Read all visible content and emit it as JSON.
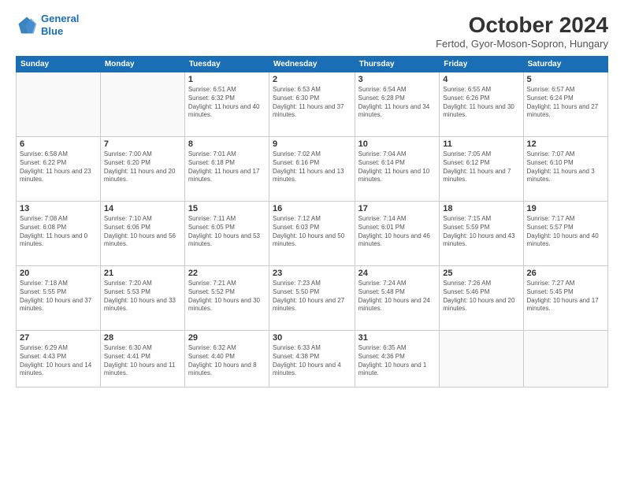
{
  "header": {
    "logo_line1": "General",
    "logo_line2": "Blue",
    "month_title": "October 2024",
    "location": "Fertod, Gyor-Moson-Sopron, Hungary"
  },
  "weekdays": [
    "Sunday",
    "Monday",
    "Tuesday",
    "Wednesday",
    "Thursday",
    "Friday",
    "Saturday"
  ],
  "weeks": [
    [
      {
        "day": "",
        "info": ""
      },
      {
        "day": "",
        "info": ""
      },
      {
        "day": "1",
        "info": "Sunrise: 6:51 AM\nSunset: 6:32 PM\nDaylight: 11 hours and 40 minutes."
      },
      {
        "day": "2",
        "info": "Sunrise: 6:53 AM\nSunset: 6:30 PM\nDaylight: 11 hours and 37 minutes."
      },
      {
        "day": "3",
        "info": "Sunrise: 6:54 AM\nSunset: 6:28 PM\nDaylight: 11 hours and 34 minutes."
      },
      {
        "day": "4",
        "info": "Sunrise: 6:55 AM\nSunset: 6:26 PM\nDaylight: 11 hours and 30 minutes."
      },
      {
        "day": "5",
        "info": "Sunrise: 6:57 AM\nSunset: 6:24 PM\nDaylight: 11 hours and 27 minutes."
      }
    ],
    [
      {
        "day": "6",
        "info": "Sunrise: 6:58 AM\nSunset: 6:22 PM\nDaylight: 11 hours and 23 minutes."
      },
      {
        "day": "7",
        "info": "Sunrise: 7:00 AM\nSunset: 6:20 PM\nDaylight: 11 hours and 20 minutes."
      },
      {
        "day": "8",
        "info": "Sunrise: 7:01 AM\nSunset: 6:18 PM\nDaylight: 11 hours and 17 minutes."
      },
      {
        "day": "9",
        "info": "Sunrise: 7:02 AM\nSunset: 6:16 PM\nDaylight: 11 hours and 13 minutes."
      },
      {
        "day": "10",
        "info": "Sunrise: 7:04 AM\nSunset: 6:14 PM\nDaylight: 11 hours and 10 minutes."
      },
      {
        "day": "11",
        "info": "Sunrise: 7:05 AM\nSunset: 6:12 PM\nDaylight: 11 hours and 7 minutes."
      },
      {
        "day": "12",
        "info": "Sunrise: 7:07 AM\nSunset: 6:10 PM\nDaylight: 11 hours and 3 minutes."
      }
    ],
    [
      {
        "day": "13",
        "info": "Sunrise: 7:08 AM\nSunset: 6:08 PM\nDaylight: 11 hours and 0 minutes."
      },
      {
        "day": "14",
        "info": "Sunrise: 7:10 AM\nSunset: 6:06 PM\nDaylight: 10 hours and 56 minutes."
      },
      {
        "day": "15",
        "info": "Sunrise: 7:11 AM\nSunset: 6:05 PM\nDaylight: 10 hours and 53 minutes."
      },
      {
        "day": "16",
        "info": "Sunrise: 7:12 AM\nSunset: 6:03 PM\nDaylight: 10 hours and 50 minutes."
      },
      {
        "day": "17",
        "info": "Sunrise: 7:14 AM\nSunset: 6:01 PM\nDaylight: 10 hours and 46 minutes."
      },
      {
        "day": "18",
        "info": "Sunrise: 7:15 AM\nSunset: 5:59 PM\nDaylight: 10 hours and 43 minutes."
      },
      {
        "day": "19",
        "info": "Sunrise: 7:17 AM\nSunset: 5:57 PM\nDaylight: 10 hours and 40 minutes."
      }
    ],
    [
      {
        "day": "20",
        "info": "Sunrise: 7:18 AM\nSunset: 5:55 PM\nDaylight: 10 hours and 37 minutes."
      },
      {
        "day": "21",
        "info": "Sunrise: 7:20 AM\nSunset: 5:53 PM\nDaylight: 10 hours and 33 minutes."
      },
      {
        "day": "22",
        "info": "Sunrise: 7:21 AM\nSunset: 5:52 PM\nDaylight: 10 hours and 30 minutes."
      },
      {
        "day": "23",
        "info": "Sunrise: 7:23 AM\nSunset: 5:50 PM\nDaylight: 10 hours and 27 minutes."
      },
      {
        "day": "24",
        "info": "Sunrise: 7:24 AM\nSunset: 5:48 PM\nDaylight: 10 hours and 24 minutes."
      },
      {
        "day": "25",
        "info": "Sunrise: 7:26 AM\nSunset: 5:46 PM\nDaylight: 10 hours and 20 minutes."
      },
      {
        "day": "26",
        "info": "Sunrise: 7:27 AM\nSunset: 5:45 PM\nDaylight: 10 hours and 17 minutes."
      }
    ],
    [
      {
        "day": "27",
        "info": "Sunrise: 6:29 AM\nSunset: 4:43 PM\nDaylight: 10 hours and 14 minutes."
      },
      {
        "day": "28",
        "info": "Sunrise: 6:30 AM\nSunset: 4:41 PM\nDaylight: 10 hours and 11 minutes."
      },
      {
        "day": "29",
        "info": "Sunrise: 6:32 AM\nSunset: 4:40 PM\nDaylight: 10 hours and 8 minutes."
      },
      {
        "day": "30",
        "info": "Sunrise: 6:33 AM\nSunset: 4:38 PM\nDaylight: 10 hours and 4 minutes."
      },
      {
        "day": "31",
        "info": "Sunrise: 6:35 AM\nSunset: 4:36 PM\nDaylight: 10 hours and 1 minute."
      },
      {
        "day": "",
        "info": ""
      },
      {
        "day": "",
        "info": ""
      }
    ]
  ]
}
